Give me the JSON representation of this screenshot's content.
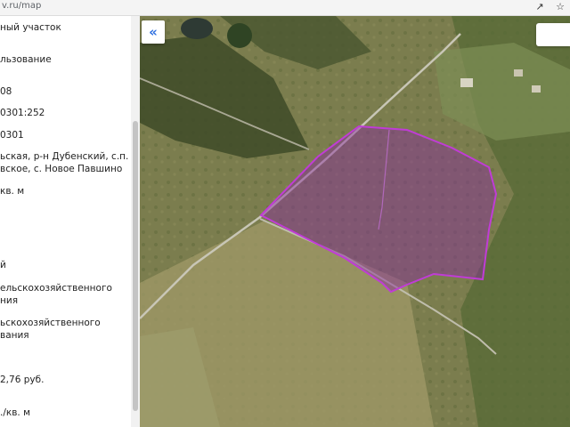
{
  "browser": {
    "url": "v.ru/map"
  },
  "parcel_info": {
    "lines": [
      "ный участок",
      "льзование",
      "08",
      "0301:252",
      "0301",
      "ьская, р-н Дубенский, с.п.",
      "вское, с. Новое Павшино",
      "кв. м",
      "й",
      "ельскохозяйственного",
      "ния",
      "ьскохозяйственного",
      "вания",
      "2,76 руб.",
      "./кв. м"
    ]
  },
  "map": {
    "collapse_button_glyph": "«",
    "parcel_outline_color": "#c03cd6",
    "parcel_fill_color": "#8a2aa0"
  }
}
